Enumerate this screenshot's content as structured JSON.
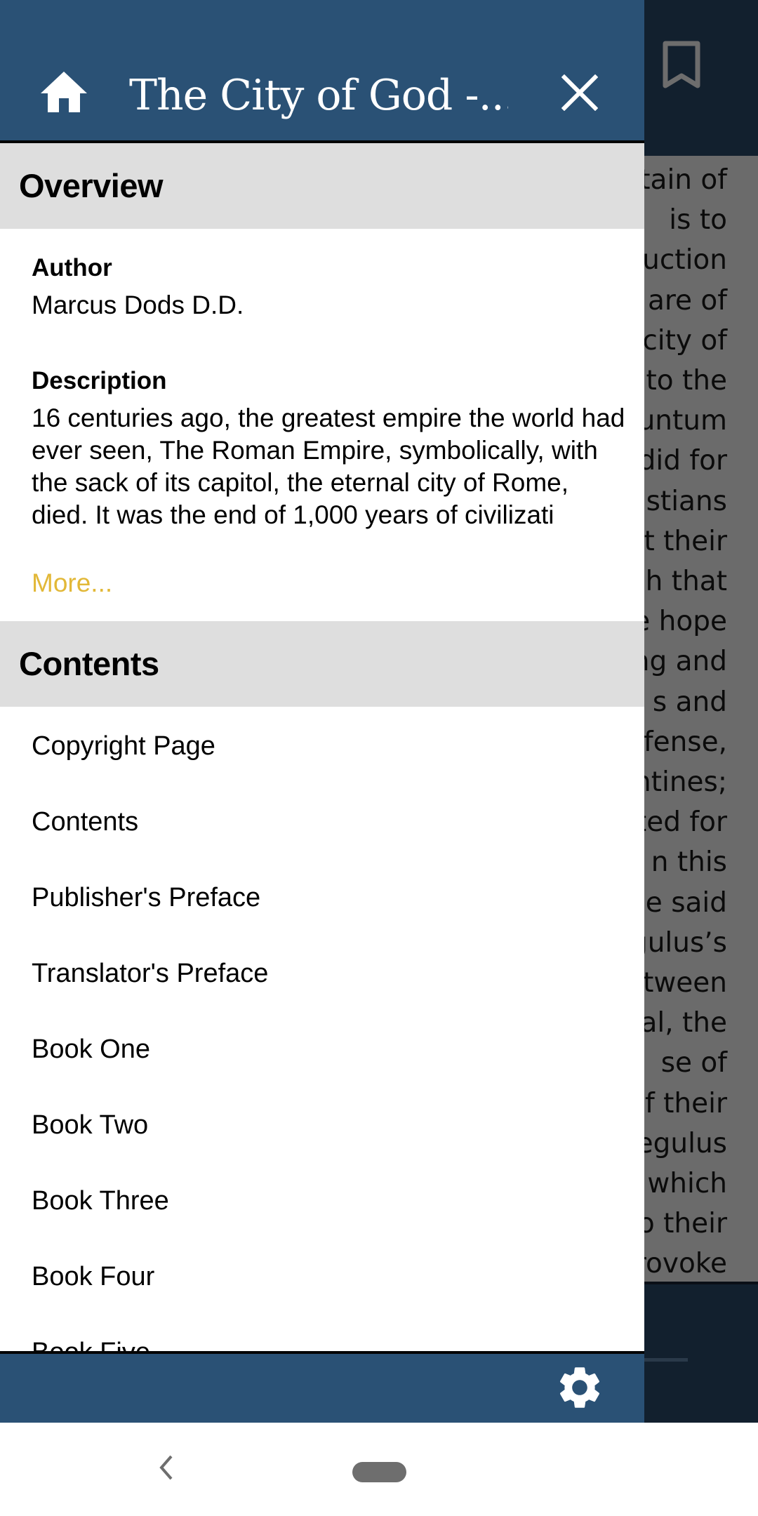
{
  "drawer": {
    "title": "The City of God -...",
    "header_icons": {
      "home": "home-icon",
      "close": "close-icon"
    },
    "overview": {
      "heading": "Overview",
      "author_label": "Author",
      "author_value": "Marcus Dods D.D.",
      "description_label": "Description",
      "description_text": "16 centuries ago, the greatest empire the world had ever seen, The Roman Empire, symbolically, with the sack of its capitol, the eternal city of Rome, died. It was the end of 1,000 years of civilizati",
      "more_link": "More..."
    },
    "contents": {
      "heading": "Contents",
      "items": [
        {
          "label": "Copyright Page"
        },
        {
          "label": "Contents"
        },
        {
          "label": "Publisher's Preface"
        },
        {
          "label": "Translator's Preface"
        },
        {
          "label": "Book One"
        },
        {
          "label": "Book Two"
        },
        {
          "label": "Book Three"
        },
        {
          "label": "Book Four"
        },
        {
          "label": "Book Five"
        }
      ]
    },
    "footer_icons": {
      "settings": "gear-icon"
    }
  },
  "reader": {
    "bookmark_icon": "bookmark-icon",
    "visible_line_fragments": [
      "tain of",
      "is  to",
      "uction",
      "are of",
      "city of",
      "to the",
      "untum",
      "did for",
      "stians",
      "t their",
      "h that",
      "e hope",
      "ng and",
      "s  and",
      "fense,",
      "ntines;",
      "ted for",
      "n  this",
      "e said",
      "gulus’s",
      "tween",
      "al,  the",
      "se   of",
      "f their",
      "egulus",
      "which",
      "o  their",
      "rovoke"
    ]
  },
  "system_nav": {
    "back": "back-icon",
    "home": "home-pill"
  },
  "colors": {
    "header_bg": "#2a5175",
    "reader_bg": "#12202e",
    "section_band": "#dedede",
    "link": "#e2b838",
    "scrim_page": "#6b6b6b"
  }
}
